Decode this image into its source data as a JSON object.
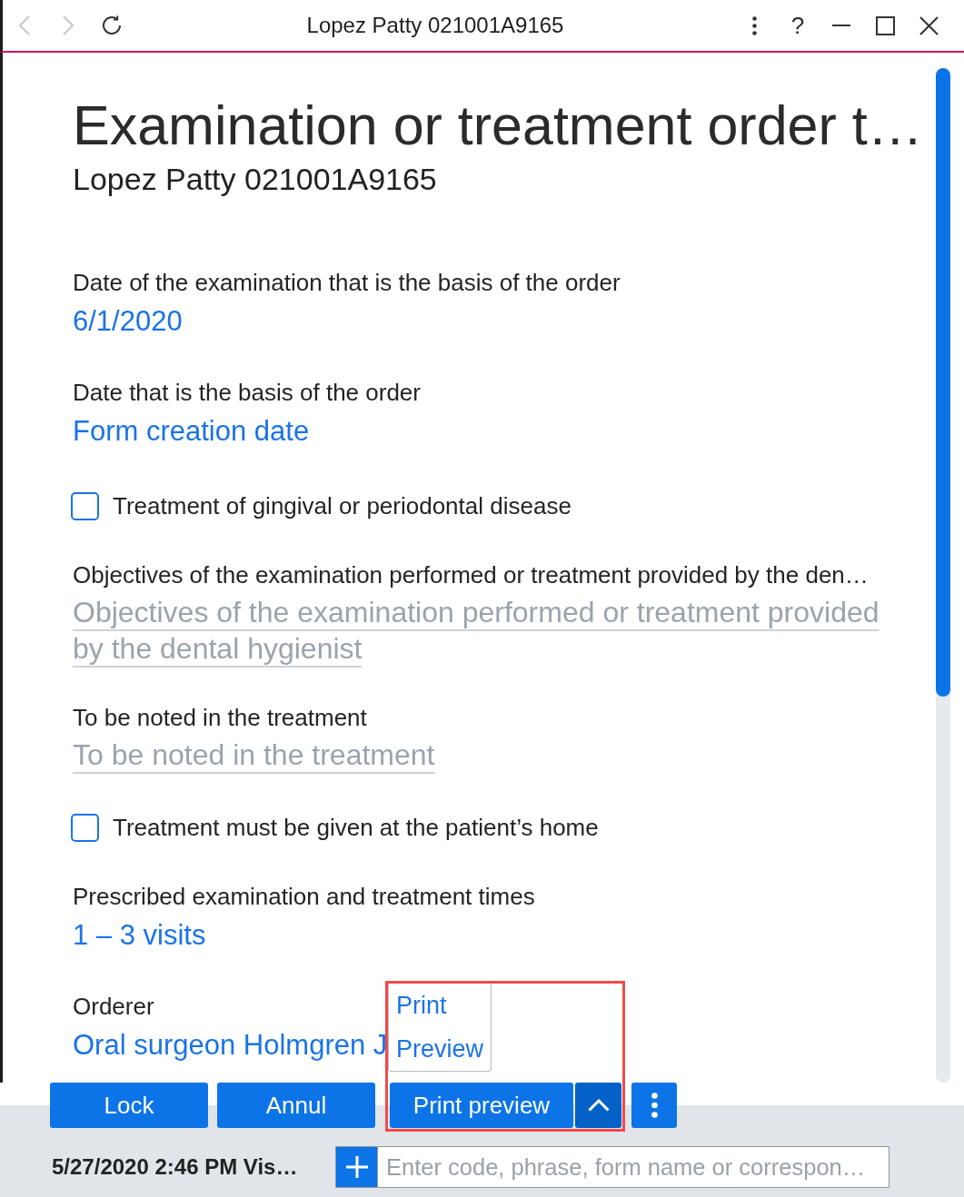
{
  "window": {
    "title": "Lopez Patty 021001A9165",
    "back": {
      "disabled": true
    },
    "forward": {
      "disabled": true
    },
    "help": "?"
  },
  "header": {
    "title": "Examination or treatment order t…",
    "subtitle": "Lopez Patty 021001A9165"
  },
  "fields": [
    {
      "kind": "value",
      "label": "Date of the examination that is the basis of the order",
      "value": "6/1/2020"
    },
    {
      "kind": "value",
      "label": "Date that is the basis of the order",
      "value": "Form creation date"
    },
    {
      "kind": "checkbox",
      "label": "Treatment of gingival or periodontal disease",
      "checked": false
    },
    {
      "kind": "text",
      "label": "Objectives of the examination performed or treatment provided by the den…",
      "placeholder": "Objectives of the examination performed or treatment provided by the dental hygienist"
    },
    {
      "kind": "text",
      "label": "To be noted in the treatment",
      "placeholder": "To be noted in the treatment"
    },
    {
      "kind": "checkbox",
      "label": "Treatment must be given at the patient’s home",
      "checked": false
    },
    {
      "kind": "value",
      "label": "Prescribed examination and treatment times",
      "value": "1 – 3 visits"
    },
    {
      "kind": "value",
      "label": "Orderer",
      "value": "Oral surgeon Holmgren J"
    }
  ],
  "buttons": [
    {
      "kind": "plain",
      "label": "Lock"
    },
    {
      "kind": "plain",
      "label": "Annul"
    },
    {
      "kind": "split",
      "label": "Print preview",
      "expanded": true,
      "highlighted": true,
      "menu": [
        "Print",
        "Preview"
      ]
    },
    {
      "kind": "more"
    }
  ],
  "status_bar": {
    "text": "5/27/2020 2:46 PM Vis…",
    "command": {
      "placeholder": "Enter code, phrase, form name or correspon…"
    }
  }
}
